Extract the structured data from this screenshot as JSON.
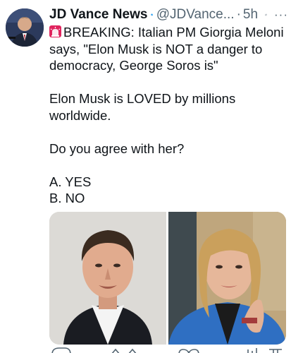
{
  "tweet": {
    "author_name": "JD Vance News",
    "handle": "@JDVance...",
    "separator": "·",
    "time": "5h",
    "more": "···",
    "icons": {
      "verified": "verified-badge-icon",
      "grok": "grok-icon",
      "alarm": "police-light-emoji"
    },
    "lines": [
      "BREAKING: Italian PM Giorgia Meloni",
      "says, \"Elon Musk is NOT a danger to",
      "democracy, George Soros is\"",
      "",
      "Elon Musk is LOVED by millions",
      "worldwide.",
      "",
      "Do you agree with her?",
      "",
      "A. YES",
      "B. NO"
    ],
    "media": [
      {
        "subject": "man in dark suit and white shirt"
      },
      {
        "subject": "woman with blonde hair in blue blazer"
      }
    ]
  },
  "colors": {
    "text": "#0f1419",
    "secondary": "#536471",
    "verified_blue": "#1d9bf0",
    "alarm_red": "#e0245e"
  }
}
